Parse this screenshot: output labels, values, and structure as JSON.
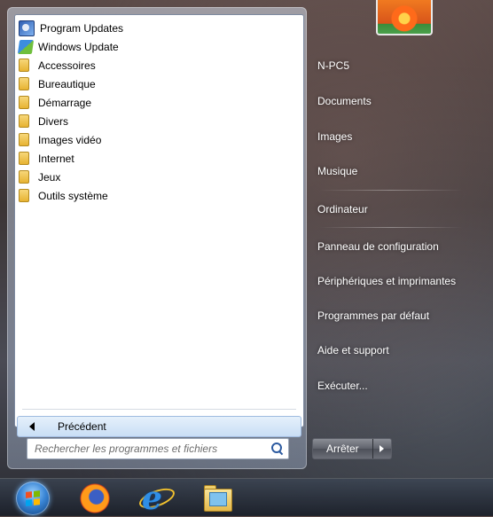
{
  "left_pane": {
    "items": [
      {
        "label": "Program Updates",
        "icon": "program-updates-icon"
      },
      {
        "label": "Windows Update",
        "icon": "windows-update-icon"
      },
      {
        "label": "Accessoires",
        "icon": "folder-icon"
      },
      {
        "label": "Bureautique",
        "icon": "folder-icon"
      },
      {
        "label": "Démarrage",
        "icon": "folder-icon"
      },
      {
        "label": "Divers",
        "icon": "folder-icon"
      },
      {
        "label": "Images vidéo",
        "icon": "folder-icon"
      },
      {
        "label": "Internet",
        "icon": "folder-icon"
      },
      {
        "label": "Jeux",
        "icon": "folder-icon"
      },
      {
        "label": "Outils système",
        "icon": "folder-icon"
      }
    ],
    "back_label": "Précédent",
    "search_placeholder": "Rechercher les programmes et fichiers"
  },
  "right_pane": {
    "user_name": "N-PC5",
    "documents": "Documents",
    "images": "Images",
    "music": "Musique",
    "computer": "Ordinateur",
    "control_panel": "Panneau de configuration",
    "devices": "Périphériques et imprimantes",
    "default_programs": "Programmes par défaut",
    "help": "Aide et support",
    "run": "Exécuter..."
  },
  "shutdown": {
    "label": "Arrêter"
  },
  "taskbar": {
    "icons": [
      "start-orb-icon",
      "firefox-icon",
      "internet-explorer-icon",
      "windows-explorer-icon"
    ]
  }
}
